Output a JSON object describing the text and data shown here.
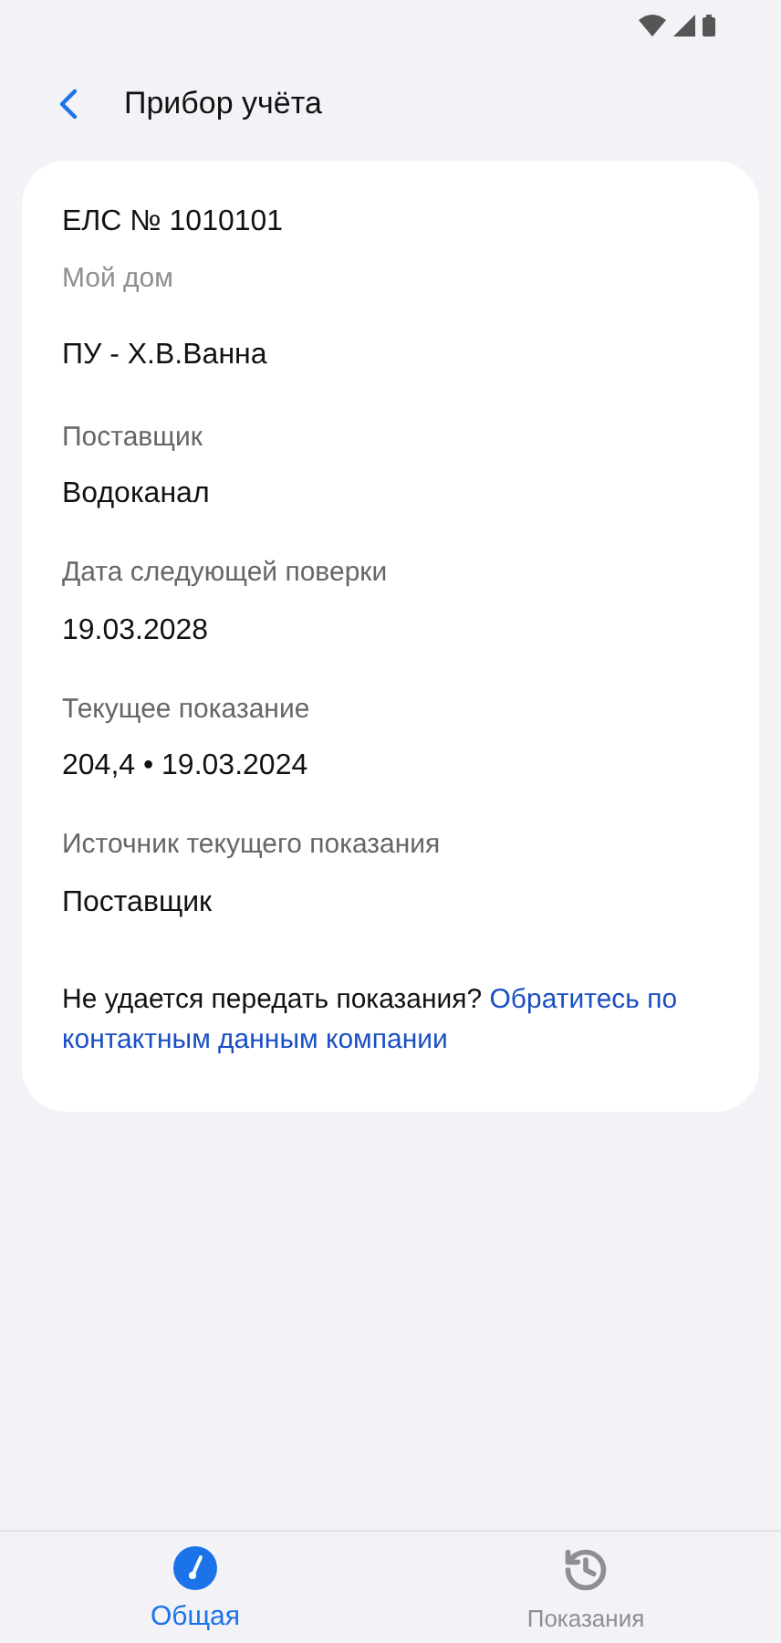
{
  "header": {
    "title": "Прибор учёта"
  },
  "card": {
    "account": "ЕЛС № 1010101",
    "address": "Мой дом",
    "meter": "ПУ - Х.В.Ванна",
    "fields": [
      {
        "label": "Поставщик",
        "value": "Водоканал"
      },
      {
        "label": "Дата следующей поверки",
        "value": "19.03.2028"
      },
      {
        "label": "Текущее показание",
        "value": "204,4 • 19.03.2024"
      },
      {
        "label": "Источник текущего показания",
        "value": "Поставщик"
      }
    ],
    "help": {
      "text": "Не удается передать показания?",
      "link_lines": [
        "Обратитесь по",
        "контактным данным компании"
      ]
    }
  },
  "tabs": [
    {
      "label": "Общая",
      "kind": "gauge",
      "selected": true
    },
    {
      "label": "Показания",
      "kind": "history",
      "selected": false
    }
  ]
}
